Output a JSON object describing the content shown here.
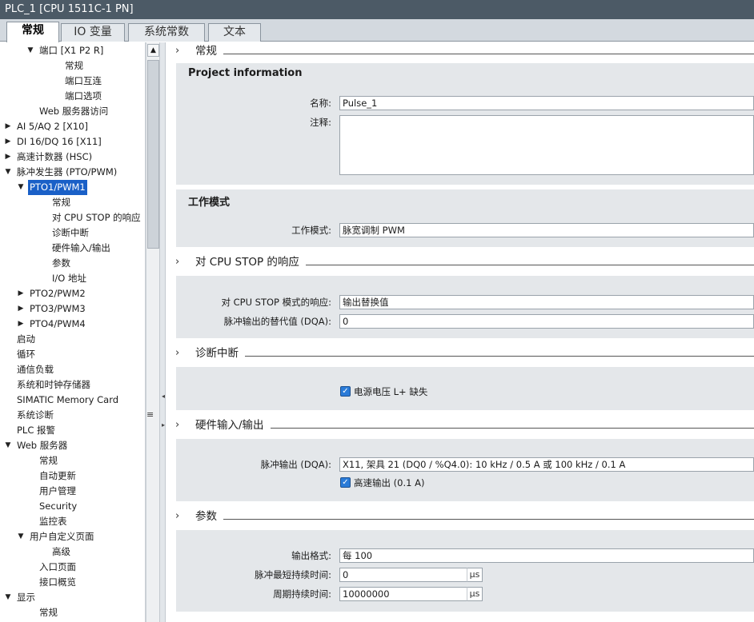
{
  "window": {
    "title": "PLC_1 [CPU 1511C-1 PN]"
  },
  "tabs": [
    "常规",
    "IO 变量",
    "系统常数",
    "文本"
  ],
  "tree": [
    {
      "label": "端口 [X1 P2 R]",
      "level": 2,
      "expand": "open"
    },
    {
      "label": "常规",
      "level": 4,
      "expand": ""
    },
    {
      "label": "端口互连",
      "level": 4,
      "expand": ""
    },
    {
      "label": "端口选项",
      "level": 4,
      "expand": ""
    },
    {
      "label": "Web 服务器访问",
      "level": 2,
      "expand": ""
    },
    {
      "label": "AI 5/AQ 2 [X10]",
      "level": 0,
      "expand": "closed"
    },
    {
      "label": "DI 16/DQ 16 [X11]",
      "level": 0,
      "expand": "closed"
    },
    {
      "label": "高速计数器 (HSC)",
      "level": 0,
      "expand": "closed"
    },
    {
      "label": "脉冲发生器 (PTO/PWM)",
      "level": 0,
      "expand": "open"
    },
    {
      "label": "PTO1/PWM1",
      "level": 1,
      "expand": "open",
      "selected": true
    },
    {
      "label": "常规",
      "level": 3,
      "expand": ""
    },
    {
      "label": "对 CPU STOP 的响应",
      "level": 3,
      "expand": ""
    },
    {
      "label": "诊断中断",
      "level": 3,
      "expand": ""
    },
    {
      "label": "硬件输入/输出",
      "level": 3,
      "expand": ""
    },
    {
      "label": "参数",
      "level": 3,
      "expand": ""
    },
    {
      "label": "I/O 地址",
      "level": 3,
      "expand": ""
    },
    {
      "label": "PTO2/PWM2",
      "level": 1,
      "expand": "closed"
    },
    {
      "label": "PTO3/PWM3",
      "level": 1,
      "expand": "closed"
    },
    {
      "label": "PTO4/PWM4",
      "level": 1,
      "expand": "closed"
    },
    {
      "label": "启动",
      "level": 0,
      "expand": ""
    },
    {
      "label": "循环",
      "level": 0,
      "expand": ""
    },
    {
      "label": "通信负载",
      "level": 0,
      "expand": ""
    },
    {
      "label": "系统和时钟存储器",
      "level": 0,
      "expand": ""
    },
    {
      "label": "SIMATIC Memory Card",
      "level": 0,
      "expand": ""
    },
    {
      "label": "系统诊断",
      "level": 0,
      "expand": ""
    },
    {
      "label": "PLC 报警",
      "level": 0,
      "expand": ""
    },
    {
      "label": "Web 服务器",
      "level": 0,
      "expand": "open"
    },
    {
      "label": "常规",
      "level": 2,
      "expand": ""
    },
    {
      "label": "自动更新",
      "level": 2,
      "expand": ""
    },
    {
      "label": "用户管理",
      "level": 2,
      "expand": ""
    },
    {
      "label": "Security",
      "level": 2,
      "expand": ""
    },
    {
      "label": "监控表",
      "level": 2,
      "expand": ""
    },
    {
      "label": "用户自定义页面",
      "level": 1,
      "expand": "open"
    },
    {
      "label": "高级",
      "level": 3,
      "expand": ""
    },
    {
      "label": "入口页面",
      "level": 2,
      "expand": ""
    },
    {
      "label": "接口概览",
      "level": 2,
      "expand": ""
    },
    {
      "label": "显示",
      "level": 0,
      "expand": "open"
    },
    {
      "label": "常规",
      "level": 2,
      "expand": ""
    }
  ],
  "sections": {
    "general": {
      "title": "常规",
      "subtitle": "Project information",
      "name_label": "名称:",
      "name_value": "Pulse_1",
      "comment_label": "注释:",
      "comment_value": ""
    },
    "mode": {
      "subtitle": "工作模式",
      "label": "工作模式:",
      "value": "脉宽调制 PWM"
    },
    "cpu_stop": {
      "title": "对 CPU STOP 的响应",
      "reaction_label": "对 CPU STOP 模式的响应:",
      "reaction_value": "输出替换值",
      "subst_label": "脉冲输出的替代值 (DQA):",
      "subst_value": "0"
    },
    "diag": {
      "title": "诊断中断",
      "checkbox_label": "电源电压 L+ 缺失",
      "checked": true
    },
    "hw": {
      "title": "硬件输入/输出",
      "output_label": "脉冲输出 (DQA):",
      "output_value": "X11, 架具 21 (DQ0 / %Q4.0): 10 kHz / 0.5 A 或 100 kHz / 0.1 A",
      "checkbox_label": "高速输出 (0.1 A)",
      "checked": true
    },
    "params": {
      "title": "参数",
      "format_label": "输出格式:",
      "format_value": "每 100",
      "min_label": "脉冲最短持续时间:",
      "min_value": "0",
      "min_unit": "μs",
      "period_label": "周期持续时间:",
      "period_value": "10000000",
      "period_unit": "μs"
    }
  }
}
